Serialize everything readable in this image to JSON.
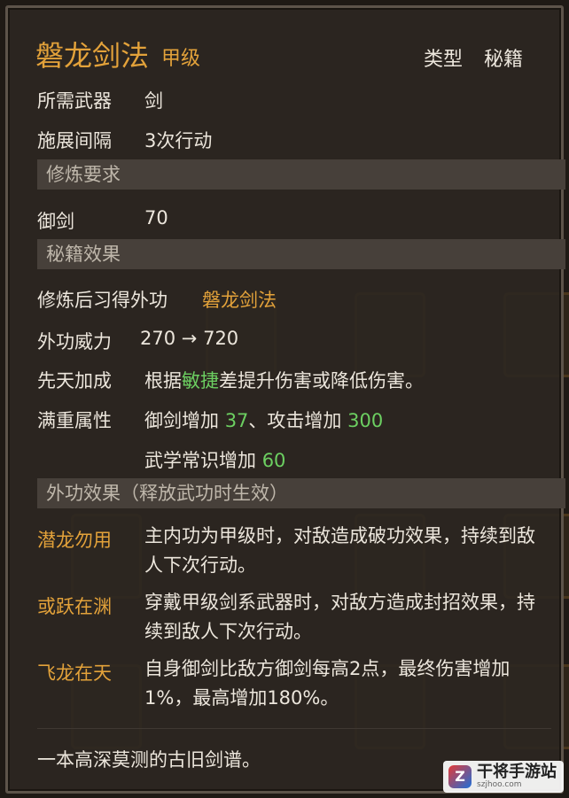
{
  "skill": {
    "name": "磐龙剑法",
    "grade": "甲级",
    "type_label": "类型",
    "type_value": "秘籍"
  },
  "weapon": {
    "label": "所需武器",
    "value": "剑"
  },
  "interval": {
    "label": "施展间隔",
    "value": "3次行动"
  },
  "requirement_section": "修炼要求",
  "requirement": {
    "label": "御剑",
    "value": "70"
  },
  "effect_section": "秘籍效果",
  "learn": {
    "label": "修炼后习得外功",
    "value": "磐龙剑法"
  },
  "power": {
    "label": "外功威力",
    "from": "270",
    "arrow": "→",
    "to": "720"
  },
  "innate": {
    "label": "先天加成",
    "pre": "根据",
    "highlight": "敏捷",
    "post": "差提升伤害或降低伤害。"
  },
  "full": {
    "label": "满重属性",
    "line1_a": "御剑增加",
    "line1_a_val": "37",
    "line1_sep": "、攻击增加",
    "line1_b_val": "300",
    "line2_a": "武学常识增加",
    "line2_a_val": "60"
  },
  "outer_section": "外功效果（释放武功时生效）",
  "effects": [
    {
      "name": "潜龙勿用",
      "desc": "主内功为甲级时，对敌造成破功效果，持续到敌人下次行动。"
    },
    {
      "name": "或跃在渊",
      "desc": "穿戴甲级剑系武器时，对敌方造成封招效果，持续到敌人下次行动。"
    },
    {
      "name": "飞龙在天",
      "desc": "自身御剑比敌方御剑每高2点，最终伤害增加1%，最高增加180%。"
    }
  ],
  "flavor": "一本高深莫测的古旧剑谱。",
  "watermark": {
    "logo": "Z",
    "title": "干将手游站",
    "sub": "szjhoo.com"
  },
  "colors": {
    "gold": "#e3a23a",
    "green": "#6ccf61",
    "text": "#ece6dc"
  }
}
